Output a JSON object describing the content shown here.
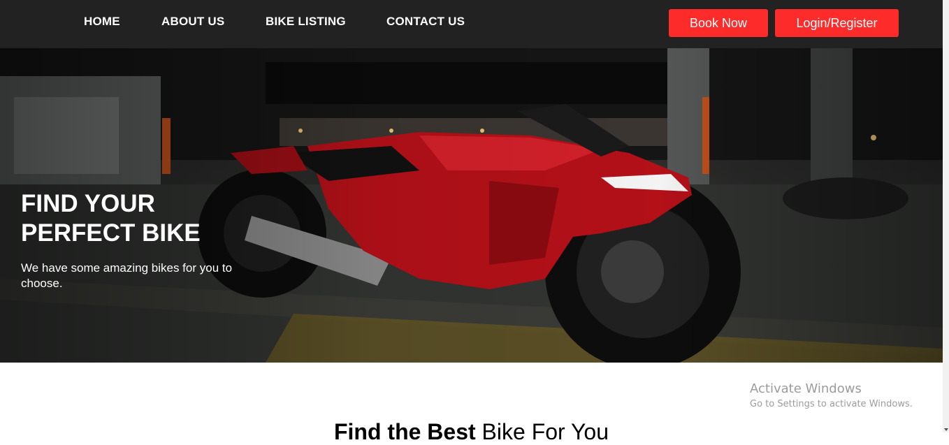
{
  "nav": {
    "links": [
      "HOME",
      "ABOUT US",
      "BIKE LISTING",
      "CONTACT US"
    ],
    "book_now": "Book Now",
    "login_register": "Login/Register"
  },
  "hero": {
    "title": "FIND YOUR PERFECT BIKE",
    "subtitle": "We have some amazing bikes for you to choose.",
    "image_subject": "red-sport-motorcycle"
  },
  "section": {
    "heading_bold": "Find the Best",
    "heading_light": " Bike For You"
  },
  "watermark": {
    "title": "Activate Windows",
    "subtitle": "Go to Settings to activate Windows."
  },
  "colors": {
    "navbar": "#222222",
    "accent": "#fe2b2b",
    "white": "#ffffff"
  }
}
